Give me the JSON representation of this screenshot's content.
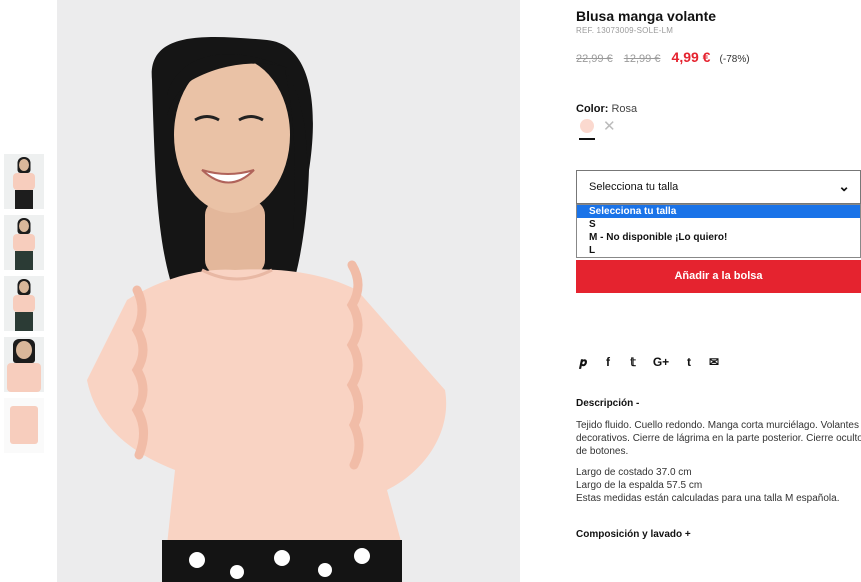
{
  "product": {
    "title": "Blusa manga volante",
    "ref": "REF. 13073009-SOLE-LM",
    "price_original": "22,99 €",
    "price_previous": "12,99 €",
    "price_current": "4,99 €",
    "discount": "(-78%)"
  },
  "color": {
    "label": "Color:",
    "value": "Rosa",
    "swatch_hex": "#fbd9cf"
  },
  "size_select": {
    "placeholder": "Selecciona tu talla",
    "options": [
      "Selecciona tu talla",
      "S",
      "M - No disponible ¡Lo quiero!",
      "L"
    ],
    "selected_index": 0
  },
  "add_to_bag": "Añadir a la bolsa",
  "share_icons": [
    "pinterest-icon",
    "facebook-icon",
    "twitter-icon",
    "google-plus-icon",
    "tumblr-icon",
    "email-icon"
  ],
  "description": {
    "heading": "Descripción -",
    "paragraph1": "Tejido fluido. Cuello redondo. Manga corta murciélago. Volantes decorativos. Cierre de lágrima en la parte posterior. Cierre oculto de botones.",
    "line1": "Largo de costado 37.0 cm",
    "line2": "Largo de la espalda 57.5 cm",
    "line3": "Estas medidas están calculadas para una talla M española."
  },
  "composition_heading": "Composición y lavado +",
  "colors": {
    "accent": "#e5232f",
    "selected_option": "#1a73e8"
  }
}
